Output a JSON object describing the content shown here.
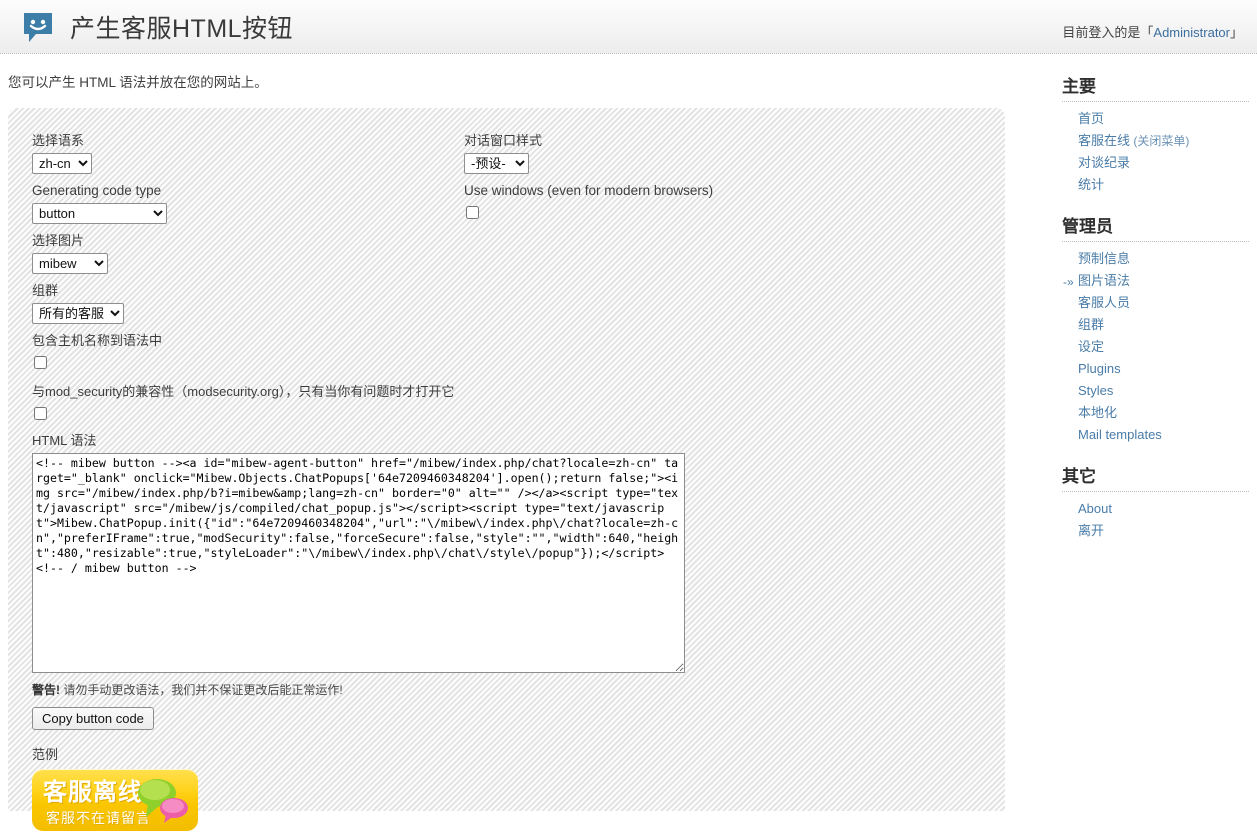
{
  "header": {
    "title": "产生客服HTML按钮",
    "logo_icon": "smiley-chat-bubble-icon",
    "login_prefix": "目前登入的是「",
    "login_user": "Administrator",
    "login_suffix": "」"
  },
  "main": {
    "intro": "您可以产生 HTML 语法并放在您的网站上。",
    "fields": {
      "locale_label": "选择语系",
      "locale_value": "zh-cn",
      "locale_options": [
        "zh-cn"
      ],
      "code_type_label": "Generating code type",
      "code_type_value": "button",
      "code_type_options": [
        "button"
      ],
      "image_label": "选择图片",
      "image_value": "mibew",
      "image_options": [
        "mibew"
      ],
      "group_label": "组群",
      "group_value": "所有的客服",
      "group_options": [
        "所有的客服"
      ],
      "hostname_label": "包含主机名称到语法中",
      "hostname_checked": false,
      "modsecurity_label": "与mod_security的兼容性（modsecurity.org），只有当你有问题时才打开它",
      "modsecurity_checked": false,
      "popup_style_label": "对话窗口样式",
      "popup_style_value": "-预设-",
      "popup_style_options": [
        "-预设-"
      ],
      "use_windows_label": "Use windows (even for modern browsers)",
      "use_windows_checked": false
    },
    "code": {
      "label": "HTML 语法",
      "value": "<!-- mibew button --><a id=\"mibew-agent-button\" href=\"/mibew/index.php/chat?locale=zh-cn\" target=\"_blank\" onclick=\"Mibew.Objects.ChatPopups['64e7209460348204'].open();return false;\"><img src=\"/mibew/index.php/b?i=mibew&amp;lang=zh-cn\" border=\"0\" alt=\"\" /></a><script type=\"text/javascript\" src=\"/mibew/js/compiled/chat_popup.js\"></script><script type=\"text/javascript\">Mibew.ChatPopup.init({\"id\":\"64e7209460348204\",\"url\":\"\\/mibew\\/index.php\\/chat?locale=zh-cn\",\"preferIFrame\":true,\"modSecurity\":false,\"forceSecure\":false,\"style\":\"\",\"width\":640,\"height\":480,\"resizable\":true,\"styleLoader\":\"\\/mibew\\/index.php\\/chat\\/style\\/popup\"});</script>\n<!-- / mibew button -->",
      "warning_bold": "警告!",
      "warning_text": " 请勿手动更改语法，我们并不保证更改后能正常运作!",
      "copy_button": "Copy button code"
    },
    "example": {
      "label": "范例",
      "badge_main": "客服离线",
      "badge_sub": "客服不在请留言",
      "badge_icon": "speech-bubbles-icon"
    }
  },
  "sidebar": {
    "sections": [
      {
        "title": "主要",
        "items": [
          {
            "label": "首页",
            "sub": "",
            "current": false
          },
          {
            "label": "客服在线",
            "sub": "(关闭菜单)",
            "current": false
          },
          {
            "label": "对谈纪录",
            "sub": "",
            "current": false
          },
          {
            "label": "统计",
            "sub": "",
            "current": false
          }
        ]
      },
      {
        "title": "管理员",
        "items": [
          {
            "label": "预制信息",
            "sub": "",
            "current": false
          },
          {
            "label": "图片语法",
            "sub": "",
            "current": true
          },
          {
            "label": "客服人员",
            "sub": "",
            "current": false
          },
          {
            "label": "组群",
            "sub": "",
            "current": false
          },
          {
            "label": "设定",
            "sub": "",
            "current": false
          },
          {
            "label": "Plugins",
            "sub": "",
            "current": false
          },
          {
            "label": "Styles",
            "sub": "",
            "current": false
          },
          {
            "label": "本地化",
            "sub": "",
            "current": false
          },
          {
            "label": "Mail templates",
            "sub": "",
            "current": false
          }
        ]
      },
      {
        "title": "其它",
        "items": [
          {
            "label": "About",
            "sub": "",
            "current": false
          },
          {
            "label": "离开",
            "sub": "",
            "current": false
          }
        ]
      }
    ],
    "current_marker": "-»"
  },
  "colors": {
    "link": "#4a7ca8",
    "accent": "#3c6ea0",
    "badge": "#ffd21c"
  }
}
